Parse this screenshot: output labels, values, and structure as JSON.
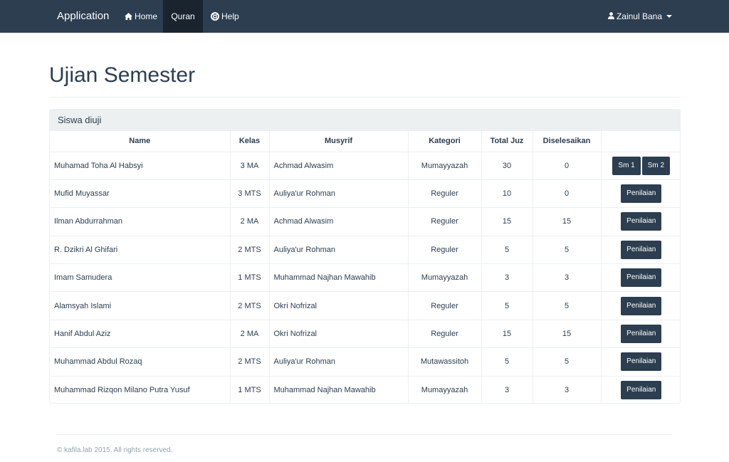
{
  "navbar": {
    "brand": "Application",
    "items": [
      {
        "label": "Home",
        "icon": "home-icon"
      },
      {
        "label": "Quran",
        "active": true
      },
      {
        "label": "Help",
        "icon": "lifebuoy-icon"
      }
    ],
    "user": {
      "label": "Zainul Bana",
      "icon": "user-icon"
    }
  },
  "page": {
    "title": "Ujian Semester"
  },
  "panel": {
    "heading": "Siswa diuji",
    "columns": [
      "Name",
      "Kelas",
      "Musyrif",
      "Kategori",
      "Total Juz",
      "Diselesaikan",
      ""
    ],
    "rows": [
      {
        "name": "Muhamad Toha Al Habsyi",
        "kelas": "3 MA",
        "musyrif": "Achmad Alwasim",
        "kategori": "Mumayyazah",
        "total_juz": "30",
        "diselesaikan": "0",
        "actions": [
          "Sm 1",
          "Sm 2"
        ]
      },
      {
        "name": "Mufid Muyassar",
        "kelas": "3 MTS",
        "musyrif": "Auliya'ur Rohman",
        "kategori": "Reguler",
        "total_juz": "10",
        "diselesaikan": "0",
        "actions": [
          "Penilaian"
        ]
      },
      {
        "name": "Ilman Abdurrahman",
        "kelas": "2 MA",
        "musyrif": "Achmad Alwasim",
        "kategori": "Reguler",
        "total_juz": "15",
        "diselesaikan": "15",
        "actions": [
          "Penilaian"
        ]
      },
      {
        "name": "R. Dzikri Al Ghifari",
        "kelas": "2 MTS",
        "musyrif": "Auliya'ur Rohman",
        "kategori": "Reguler",
        "total_juz": "5",
        "diselesaikan": "5",
        "actions": [
          "Penilaian"
        ]
      },
      {
        "name": "Imam Samudera",
        "kelas": "1 MTS",
        "musyrif": "Muhammad Najhan Mawahib",
        "kategori": "Mumayyazah",
        "total_juz": "3",
        "diselesaikan": "3",
        "actions": [
          "Penilaian"
        ]
      },
      {
        "name": "Alamsyah Islami",
        "kelas": "2 MTS",
        "musyrif": "Okri Nofrizal",
        "kategori": "Reguler",
        "total_juz": "5",
        "diselesaikan": "5",
        "actions": [
          "Penilaian"
        ]
      },
      {
        "name": "Hanif Abdul Aziz",
        "kelas": "2 MA",
        "musyrif": "Okri Nofrizal",
        "kategori": "Reguler",
        "total_juz": "15",
        "diselesaikan": "15",
        "actions": [
          "Penilaian"
        ]
      },
      {
        "name": "Muhammad Abdul Rozaq",
        "kelas": "2 MTS",
        "musyrif": "Auliya'ur Rohman",
        "kategori": "Mutawassitoh",
        "total_juz": "5",
        "diselesaikan": "5",
        "actions": [
          "Penilaian"
        ]
      },
      {
        "name": "Muhammad Rizqon Milano Putra Yusuf",
        "kelas": "1 MTS",
        "musyrif": "Muhammad Najhan Mawahib",
        "kategori": "Mumayyazah",
        "total_juz": "3",
        "diselesaikan": "3",
        "actions": [
          "Penilaian"
        ]
      }
    ]
  },
  "footer": {
    "text": "© kafila.lab 2015. All rights reserved."
  },
  "colors": {
    "navbar": "#2c3e50",
    "active_nav": "#1a242f",
    "panel_heading": "#ecf0f1",
    "button": "#2c3e50"
  }
}
